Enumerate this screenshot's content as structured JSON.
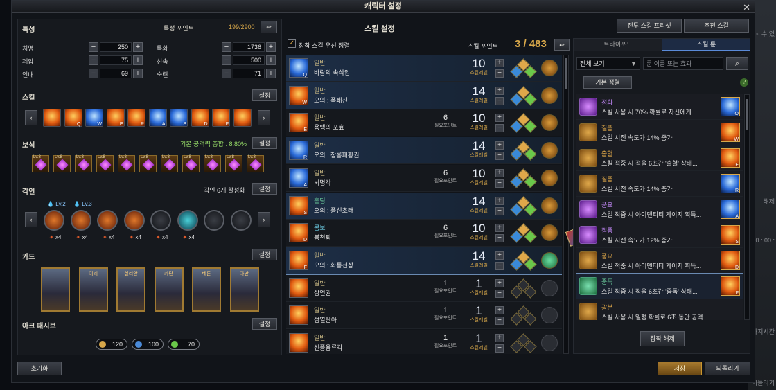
{
  "window": {
    "title": "캐릭터 설정",
    "close": "✕"
  },
  "side": {
    "t1": "< 수 있",
    "t2": "해제",
    "t3": "0 : 00 :",
    "t4": "하지시간",
    "t5": "되돌리기"
  },
  "stats": {
    "title": "특성",
    "points_label": "특성 포인트",
    "points_value": "199/2900",
    "rows": [
      {
        "label": "치명",
        "value": "250"
      },
      {
        "label": "특화",
        "value": "1736"
      },
      {
        "label": "제압",
        "value": "75"
      },
      {
        "label": "신속",
        "value": "500"
      },
      {
        "label": "인내",
        "value": "69"
      },
      {
        "label": "숙련",
        "value": "71"
      }
    ]
  },
  "skill_bar": {
    "title": "스킬",
    "settings": "설정",
    "keys": [
      "Q",
      "W",
      "E",
      "R",
      "A",
      "S",
      "D",
      "F"
    ]
  },
  "gems": {
    "title": "보석",
    "summary": "기본 공격력 총합 : 8.80%",
    "settings": "설정",
    "level": "Lv.8",
    "count": 11
  },
  "engravings": {
    "title": "각인",
    "summary": "각인 6개 활성화",
    "settings": "설정",
    "lv1": "Lv.2",
    "lv2": "Lv.3",
    "stacks": [
      "x4",
      "x4",
      "x4",
      "x4",
      "x4",
      "x4"
    ]
  },
  "cards": {
    "title": "카드",
    "settings": "설정",
    "names": [
      "",
      "이레",
      "실리안",
      "카단",
      "베른",
      "아만"
    ]
  },
  "ark": {
    "title": "아크 패시브",
    "settings": "설정",
    "values": [
      "120",
      "100",
      "70"
    ],
    "colors": [
      "#d7a74a",
      "#4a8ad8",
      "#6ac84a"
    ]
  },
  "reset": "초기화",
  "skills": {
    "title": "스킬 설정",
    "auto_sort": "장착 스킬 우선 정렬",
    "points_label": "스킬 포인트",
    "points_value": "3 / 483",
    "lvl_label": "스킬레벨",
    "need_label": "필요포인트",
    "list": [
      {
        "type": "일반",
        "name": "바람의 속삭임",
        "points": "",
        "level": "10",
        "key": "Q",
        "icon": "blue",
        "rune": "gold"
      },
      {
        "type": "일반",
        "name": "오의 : 폭쇄진",
        "points": "",
        "level": "14",
        "key": "W",
        "icon": "fire",
        "rune": "gold"
      },
      {
        "type": "일반",
        "name": "용맹의 포효",
        "points": "6",
        "level": "10",
        "key": "E",
        "icon": "fire",
        "rune": "gold"
      },
      {
        "type": "일반",
        "name": "오의 : 창룡패황권",
        "points": "",
        "level": "14",
        "key": "R",
        "icon": "blue",
        "rune": "gold"
      },
      {
        "type": "일반",
        "name": "뇌명각",
        "points": "6",
        "level": "10",
        "key": "A",
        "icon": "blue",
        "rune": "gold"
      },
      {
        "type": "홀딩",
        "name": "오의 : 풍신초래",
        "points": "",
        "level": "14",
        "key": "S",
        "icon": "fire",
        "rune": "gold"
      },
      {
        "type": "콤보",
        "name": "붕천퇴",
        "points": "6",
        "level": "10",
        "key": "D",
        "icon": "fire",
        "rune": "gold"
      },
      {
        "type": "일반",
        "name": "오의 : 화룡천상",
        "points": "",
        "level": "14",
        "key": "F",
        "icon": "fire",
        "rune": "green"
      },
      {
        "type": "일반",
        "name": "삼연권",
        "points": "1",
        "level": "1",
        "key": "",
        "icon": "fire",
        "rune": "empty"
      },
      {
        "type": "일반",
        "name": "섬열란아",
        "points": "1",
        "level": "1",
        "key": "",
        "icon": "fire",
        "rune": "empty"
      },
      {
        "type": "일반",
        "name": "선풍용류각",
        "points": "1",
        "level": "1",
        "key": "",
        "icon": "fire",
        "rune": "empty"
      }
    ]
  },
  "presets": {
    "battle": "전투 스킬 프리셋",
    "recommend": "추천 스킬"
  },
  "runes": {
    "tab_tripod": "트라이포드",
    "tab_rune": "스킬 룬",
    "filter": "전체 보기",
    "search_placeholder": "룬 이름 또는 효과",
    "sort": "기본 정렬",
    "unequip": "장착 해제",
    "list": [
      {
        "name": "정화",
        "color": "#c88cff",
        "desc": "스킬 사용 시 70% 확률로 자신에게 ...",
        "icon": "purple",
        "key": "Q",
        "sk": "blue"
      },
      {
        "name": "질풍",
        "color": "#e0a84a",
        "desc": "스킬 시전 속도가 14% 증가",
        "icon": "",
        "key": "W",
        "sk": "fire"
      },
      {
        "name": "출혈",
        "color": "#e0a84a",
        "desc": "스킬 적중 시 적을 6초간 '출혈' 상태...",
        "icon": "",
        "key": "E",
        "sk": "fire"
      },
      {
        "name": "질풍",
        "color": "#e0a84a",
        "desc": "스킬 시전 속도가 14% 증가",
        "icon": "",
        "key": "R",
        "sk": "blue"
      },
      {
        "name": "풍요",
        "color": "#c88cff",
        "desc": "스킬 적중 시 아이덴티티 게이지 획득...",
        "icon": "purple",
        "key": "A",
        "sk": "blue"
      },
      {
        "name": "질풍",
        "color": "#c88cff",
        "desc": "스킬 시전 속도가 12% 증가",
        "icon": "purple",
        "key": "S",
        "sk": "fire"
      },
      {
        "name": "풍요",
        "color": "#e0a84a",
        "desc": "스킬 적중 시 아이덴티티 게이지 획득...",
        "icon": "",
        "key": "D",
        "sk": "fire"
      },
      {
        "name": "중독",
        "color": "#6ac89a",
        "desc": "스킬 적중 시 적을 6초간 '중독' 상태...",
        "icon": "green",
        "key": "F",
        "sk": "fire"
      },
      {
        "name": "광분",
        "color": "#e0a84a",
        "desc": "스킬 사용 시 일정 확률로 6초 동안 공격 ...",
        "icon": "",
        "key": "",
        "sk": ""
      }
    ]
  },
  "footer": {
    "save": "저장",
    "revert": "되돌리기"
  }
}
